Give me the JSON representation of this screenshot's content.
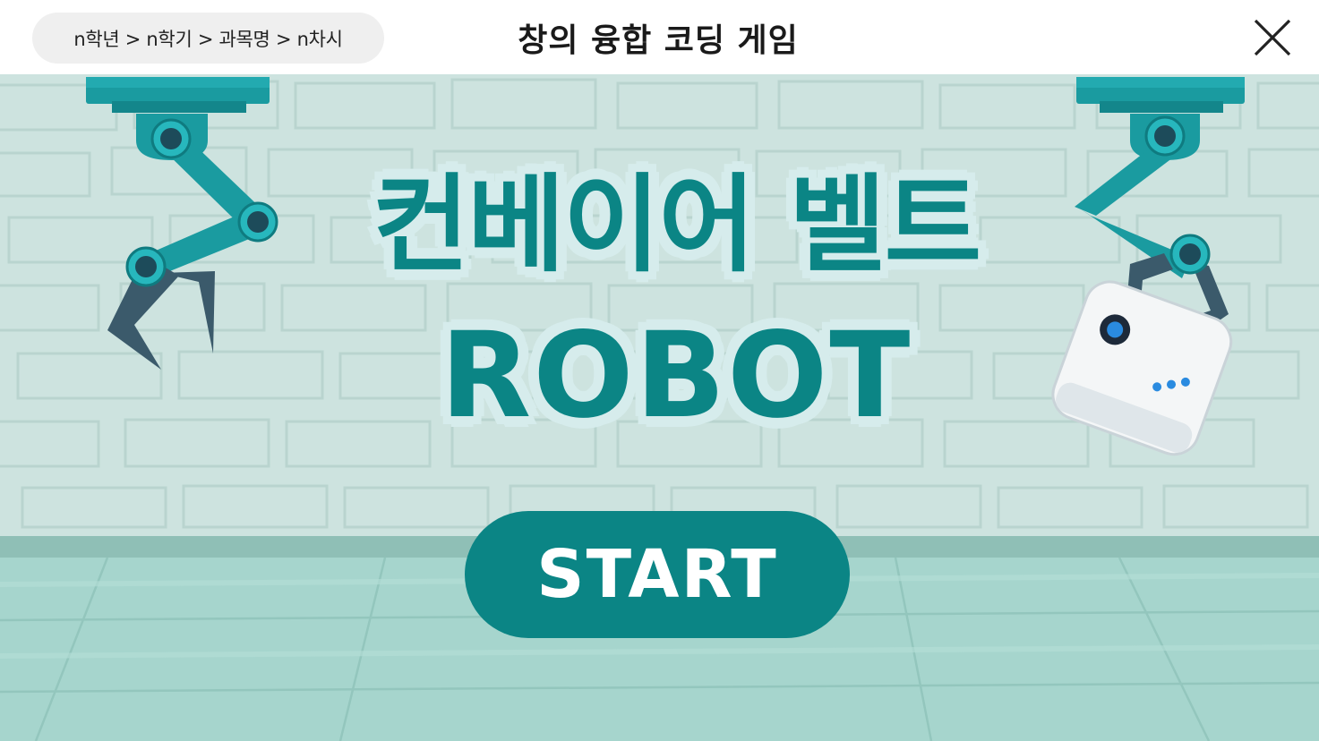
{
  "header": {
    "breadcrumb": "n학년 > n학기 > 과목명 > n차시",
    "title": "창의 융합 코딩 게임",
    "close_icon": "close-icon"
  },
  "game": {
    "title": "컨베이어 벨트",
    "subtitle": "ROBOT",
    "start_label": "START"
  },
  "colors": {
    "accent": "#0b8585",
    "wall": "#cde3df",
    "floor": "#9fd0c8",
    "arm": "#1a9ba0",
    "arm_dark": "#0f7b80",
    "claw": "#3b5a6b"
  },
  "icons": [
    "robot-arm-left",
    "robot-arm-right",
    "robot-device",
    "close-icon"
  ]
}
